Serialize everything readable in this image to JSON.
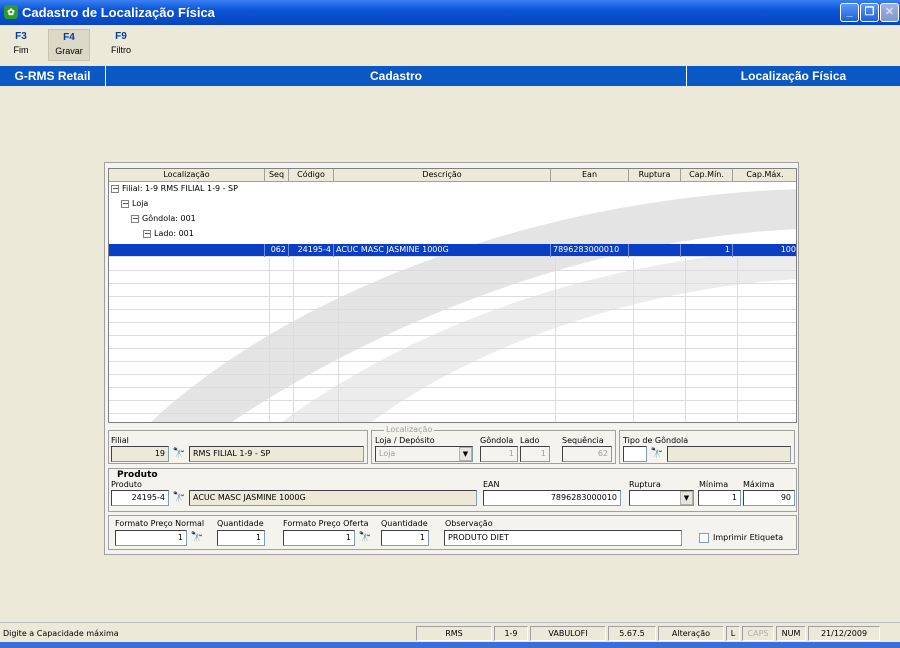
{
  "window": {
    "title": "Cadastro de Localização Física"
  },
  "toolbar": [
    {
      "key": "F3",
      "label": "Fim"
    },
    {
      "key": "F4",
      "label": "Gravar"
    },
    {
      "key": "F9",
      "label": "Filtro"
    }
  ],
  "header": {
    "left": "G-RMS Retail",
    "center": "Cadastro",
    "right": "Localização Física"
  },
  "grid": {
    "columns": [
      "Localização",
      "Seq",
      "Código",
      "Descrição",
      "Ean",
      "Ruptura",
      "Cap.Mín.",
      "Cap.Máx."
    ],
    "tree": [
      "Filial: 1-9   RMS FILIAL 1-9 - SP",
      "Loja",
      "Gôndola: 001",
      "Lado: 001"
    ],
    "row": {
      "seq": "062",
      "codigo": "24195-4",
      "descricao": "ACUC MASC JASMINE 1000G",
      "ean": "7896283000010",
      "ruptura": "",
      "capmin": "1",
      "capmax": "100"
    }
  },
  "filial": {
    "label": "Filial",
    "code": "19",
    "name": "RMS FILIAL 1-9 - SP"
  },
  "localizacao": {
    "label": "Localização",
    "loja_label": "Loja / Depósito",
    "loja_value": "Loja",
    "gondola_label": "Gôndola",
    "gondola_value": "1",
    "lado_label": "Lado",
    "lado_value": "1",
    "seq_label": "Sequência",
    "seq_value": "62"
  },
  "tipo_gondola": {
    "label": "Tipo de Gôndola"
  },
  "produto": {
    "section": "Produto",
    "label": "Produto",
    "code": "24195-4",
    "name": "ACUC MASC JASMINE 1000G",
    "ean_label": "EAN",
    "ean_value": "7896283000010",
    "ruptura_label": "Ruptura",
    "minima_label": "Mínima",
    "minima_value": "1",
    "maxima_label": "Máxima",
    "maxima_value": "90"
  },
  "precos": {
    "fpn_label": "Formato Preço Normal",
    "fpn_value": "1",
    "qtd1_label": "Quantidade",
    "qtd1_value": "1",
    "fpo_label": "Formato Preço Oferta",
    "fpo_value": "1",
    "qtd2_label": "Quantidade",
    "qtd2_value": "1",
    "obs_label": "Observação",
    "obs_value": "PRODUTO DIET",
    "imprimir_label": "Imprimir Etiqueta"
  },
  "status": {
    "message": "Digite a Capacidade máxima",
    "system": "RMS",
    "filial": "1-9",
    "user": "VABULOFI",
    "version": "5.67.5",
    "mode": "Alteração",
    "l": "L",
    "caps": "CAPS",
    "num": "NUM",
    "date": "21/12/2009"
  }
}
